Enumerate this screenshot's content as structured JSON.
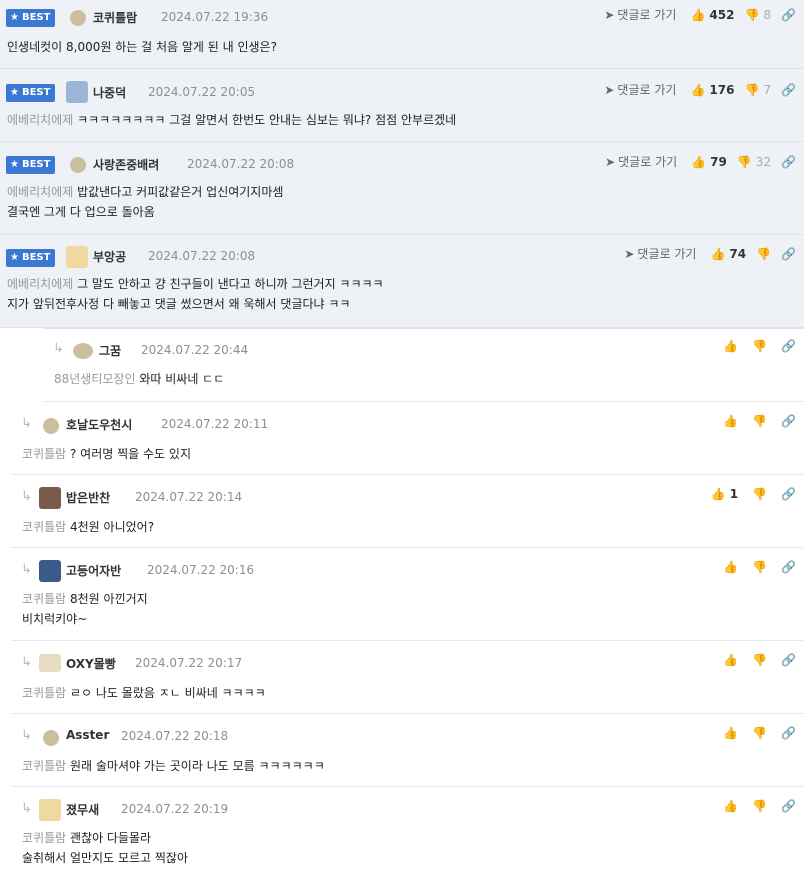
{
  "best_label": "BEST",
  "goto_label": "댓글로 가기",
  "best_comments": [
    {
      "nick": "코퀴틀람",
      "date": "2024.07.22 19:36",
      "up": "452",
      "down": "8",
      "to": "",
      "lines": [
        "인생네컷이 8,000원 하는 걸 처음 알게 된 내 인생은?"
      ]
    },
    {
      "nick": "나중덕",
      "date": "2024.07.22 20:05",
      "up": "176",
      "down": "7",
      "to": "에베리치에제",
      "lines": [
        "ㅋㅋㅋㅋㅋㅋㅋㅋ 그걸 알면서 한번도 안내는 심보는 뭐냐? 점점 안부르겠네"
      ]
    },
    {
      "nick": "사랑존중배려",
      "date": "2024.07.22 20:08",
      "up": "79",
      "down": "32",
      "to": "에베리치에제",
      "lines": [
        "밥값낸다고 커피값같은거 업신여기지마셈",
        "결국엔 그게 다 업으로 돌아옴"
      ]
    },
    {
      "nick": "부앙공",
      "date": "2024.07.22 20:08",
      "up": "74",
      "down": "",
      "to": "에베리치에제",
      "lines": [
        "그 말도 안하고 걍 친구들이 낸다고 하니까 그런거지 ㅋㅋㅋㅋ",
        "지가 앞뒤전후사정 다 빼놓고 댓글 썼으면서 왜 욱해서 댓글다냐 ㅋㅋ"
      ]
    }
  ],
  "replies": [
    {
      "nick": "그꿈",
      "date": "2024.07.22 20:44",
      "up": "",
      "to": "88년생티모장인",
      "lines": [
        "와따 비싸네 ㄷㄷ"
      ]
    },
    {
      "nick": "호날도우천시",
      "date": "2024.07.22 20:11",
      "up": "",
      "to": "코퀴틀람",
      "lines": [
        "? 여러명 찍을 수도 있지"
      ]
    },
    {
      "nick": "밥은반찬",
      "date": "2024.07.22 20:14",
      "up": "1",
      "to": "코퀴틀람",
      "lines": [
        "4천원 아니었어?"
      ]
    },
    {
      "nick": "고등어자반",
      "date": "2024.07.22 20:16",
      "up": "",
      "to": "코퀴틀람",
      "lines": [
        "8천원 아낀거지",
        "비치럭키야~"
      ]
    },
    {
      "nick": "OXY몰빵",
      "date": "2024.07.22 20:17",
      "up": "",
      "to": "코퀴틀람",
      "lines": [
        "ㄹㅇ 나도 몰랐음 ㅈㄴ 비싸네 ㅋㅋㅋㅋ"
      ]
    },
    {
      "nick": "Asster",
      "date": "2024.07.22 20:18",
      "up": "",
      "to": "코퀴틀람",
      "lines": [
        "원래 술마셔야 가는 곳이라 나도 모름 ㅋㅋㅋㅋㅋㅋ"
      ]
    },
    {
      "nick": "졌무새",
      "date": "2024.07.22 20:19",
      "up": "",
      "to": "코퀴틀람",
      "lines": [
        "괜찮아 다들몰라",
        "술취해서 얼만지도 모르고 찍잖아"
      ]
    }
  ],
  "colors": {
    "accent": "#3a78d3",
    "best_bg": "#eef1f5"
  }
}
